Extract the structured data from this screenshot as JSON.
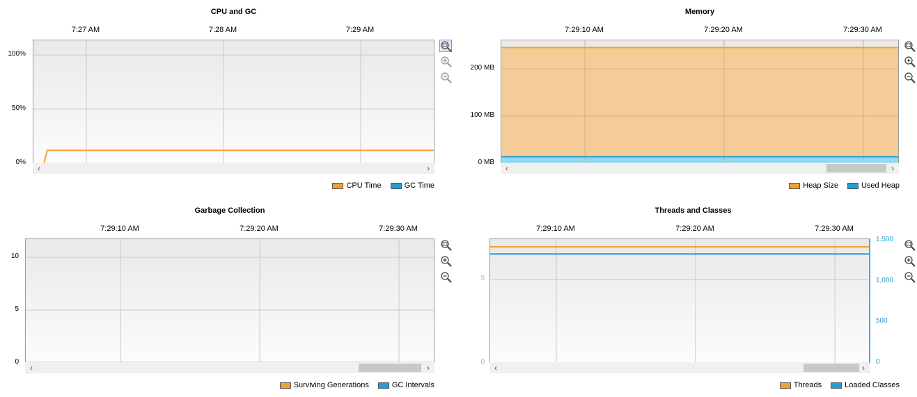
{
  "colors": {
    "orange": "#f2a035",
    "blue": "#1e9fd6",
    "heap_fill": "#f5cb97",
    "used_fill": "#8fdaf2"
  },
  "cpu_gc": {
    "title": "CPU and GC",
    "xticks": [
      "7:27 AM",
      "7:28 AM",
      "7:29 AM"
    ],
    "yticks": [
      "100%",
      "50%",
      "0%"
    ],
    "legend": [
      "CPU Time",
      "GC Time"
    ],
    "zoom_icons": [
      "zoom-fit-icon",
      "zoom-in-icon",
      "zoom-out-icon"
    ]
  },
  "memory": {
    "title": "Memory",
    "xticks": [
      "7:29:10 AM",
      "7:29:20 AM",
      "7:29:30 AM"
    ],
    "yticks": [
      "200 MB",
      "100 MB",
      "0 MB"
    ],
    "legend": [
      "Heap Size",
      "Used Heap"
    ],
    "zoom_icons": [
      "zoom-fit-icon",
      "zoom-in-icon",
      "zoom-out-icon"
    ]
  },
  "garbage": {
    "title": "Garbage Collection",
    "xticks": [
      "7:29:10 AM",
      "7:29:20 AM",
      "7:29:30 AM"
    ],
    "yticks": [
      "10",
      "5",
      "0"
    ],
    "legend": [
      "Surviving Generations",
      "GC Intervals"
    ],
    "zoom_icons": [
      "zoom-fit-icon",
      "zoom-in-icon",
      "zoom-out-icon"
    ]
  },
  "threads": {
    "title": "Threads and Classes",
    "xticks": [
      "7:29:10 AM",
      "7:29:20 AM",
      "7:29:30 AM"
    ],
    "yticks_left": [
      "5",
      "0"
    ],
    "yticks_right": [
      "1,500",
      "1,000",
      "500",
      "0"
    ],
    "legend": [
      "Threads",
      "Loaded Classes"
    ],
    "zoom_icons": [
      "zoom-fit-icon",
      "zoom-in-icon",
      "zoom-out-icon"
    ]
  },
  "chart_data": [
    {
      "type": "line",
      "title": "CPU and GC",
      "x": [
        "7:27 AM",
        "7:28 AM",
        "7:29 AM"
      ],
      "ylim": [
        0,
        100
      ],
      "series": [
        {
          "name": "CPU Time",
          "level_percent": 12
        },
        {
          "name": "GC Time",
          "level_percent": 0
        }
      ]
    },
    {
      "type": "area",
      "title": "Memory",
      "x": [
        "7:29:10 AM",
        "7:29:20 AM",
        "7:29:30 AM"
      ],
      "ylim_mb": [
        0,
        200
      ],
      "series": [
        {
          "name": "Heap Size",
          "level_mb": 245
        },
        {
          "name": "Used Heap",
          "level_mb": 14
        }
      ]
    },
    {
      "type": "line",
      "title": "Garbage Collection",
      "x": [
        "7:29:10 AM",
        "7:29:20 AM",
        "7:29:30 AM"
      ],
      "ylim": [
        0,
        10
      ],
      "series": [
        {
          "name": "Surviving Generations",
          "level": 0
        },
        {
          "name": "GC Intervals",
          "level": 0
        }
      ]
    },
    {
      "type": "line",
      "title": "Threads and Classes",
      "x": [
        "7:29:10 AM",
        "7:29:20 AM",
        "7:29:30 AM"
      ],
      "ylim_left": [
        0,
        5
      ],
      "ylim_right": [
        0,
        1500
      ],
      "series": [
        {
          "name": "Threads",
          "axis": "left",
          "level": 7
        },
        {
          "name": "Loaded Classes",
          "axis": "right",
          "level": 1340
        }
      ]
    }
  ]
}
